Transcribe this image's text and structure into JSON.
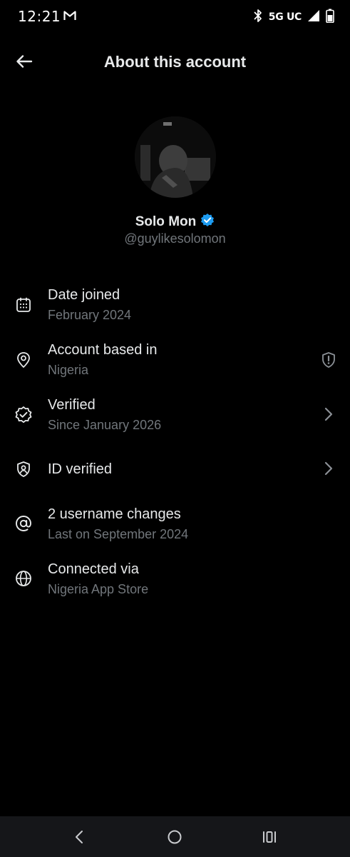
{
  "status_bar": {
    "time": "12:21",
    "network": "5G UC",
    "icons": [
      "gmail-icon",
      "bluetooth-icon",
      "signal-icon",
      "battery-icon"
    ]
  },
  "header": {
    "title": "About this account",
    "back_icon": "arrow-left-icon"
  },
  "profile": {
    "name": "Solo Mon",
    "handle": "@guylikesolomon",
    "verified_badge_color": "#1d9bf0"
  },
  "info_items": [
    {
      "title": "Date joined",
      "subtitle": "February 2024",
      "icon": "calendar-icon"
    },
    {
      "title": "Account based in",
      "subtitle": "Nigeria",
      "icon": "location-pin-icon",
      "trailing": "shield-alert-icon"
    },
    {
      "title": "Verified",
      "subtitle": "Since January 2026",
      "icon": "verified-badge-icon",
      "trailing": "chevron-right-icon"
    },
    {
      "title": "ID verified",
      "subtitle": "",
      "icon": "id-shield-icon",
      "trailing": "chevron-right-icon"
    },
    {
      "title": "2 username changes",
      "subtitle": "Last on September 2024",
      "icon": "at-sign-icon"
    },
    {
      "title": "Connected via",
      "subtitle": "Nigeria App Store",
      "icon": "globe-icon"
    }
  ],
  "nav_bar": {
    "buttons": [
      "back-nav-icon",
      "home-nav-icon",
      "recents-nav-icon"
    ]
  },
  "colors": {
    "background": "#000000",
    "primary_text": "#e7e9ea",
    "secondary_text": "#71767b",
    "accent": "#1d9bf0",
    "nav_bar": "#151619"
  }
}
